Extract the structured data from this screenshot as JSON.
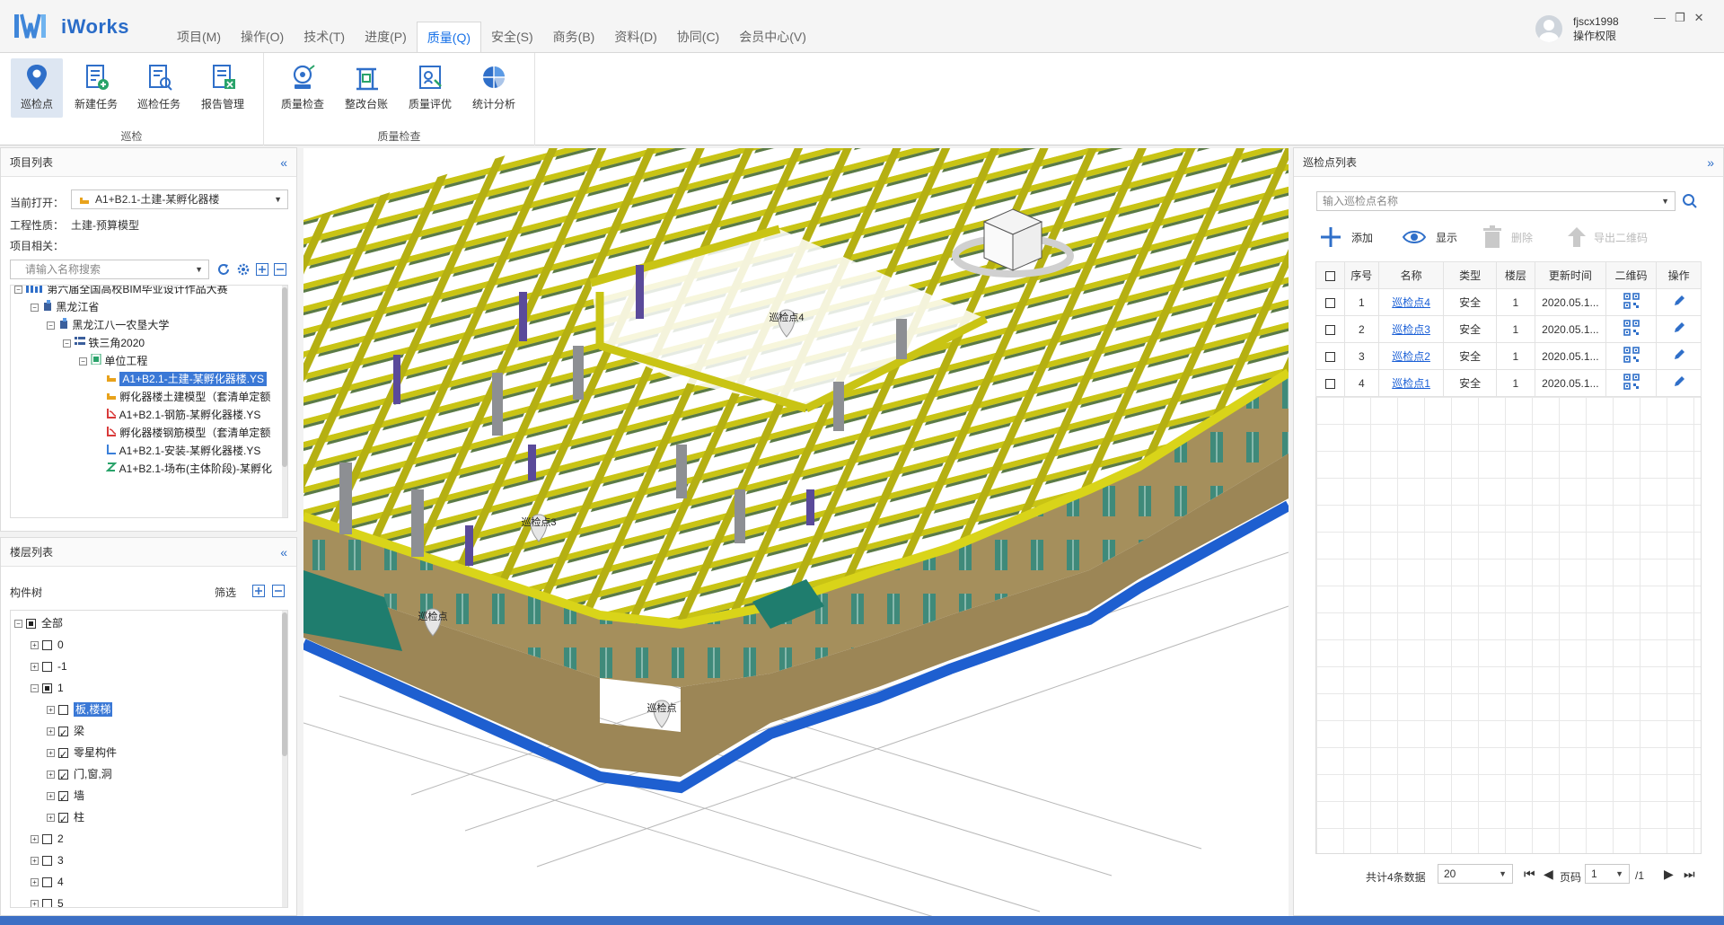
{
  "app": {
    "name": "iWorks"
  },
  "menu": [
    {
      "label": "项目(M)",
      "active": false
    },
    {
      "label": "操作(O)",
      "active": false
    },
    {
      "label": "技术(T)",
      "active": false
    },
    {
      "label": "进度(P)",
      "active": false
    },
    {
      "label": "质量(Q)",
      "active": true
    },
    {
      "label": "安全(S)",
      "active": false
    },
    {
      "label": "商务(B)",
      "active": false
    },
    {
      "label": "资料(D)",
      "active": false
    },
    {
      "label": "协同(C)",
      "active": false
    },
    {
      "label": "会员中心(V)",
      "active": false
    }
  ],
  "user": {
    "name": "fjscx1998",
    "role": "操作权限"
  },
  "window_controls": {
    "minimize": "—",
    "restore": "❐",
    "close": "✕"
  },
  "ribbon": {
    "group1": {
      "label": "巡检",
      "buttons": [
        {
          "label": "巡检点",
          "icon": "map-pin-icon",
          "selected": true
        },
        {
          "label": "新建任务",
          "icon": "new-task-icon"
        },
        {
          "label": "巡检任务",
          "icon": "inspection-task-icon"
        },
        {
          "label": "报告管理",
          "icon": "report-management-icon"
        }
      ]
    },
    "group2": {
      "label": "质量检查",
      "buttons": [
        {
          "label": "质量检查",
          "icon": "quality-check-icon"
        },
        {
          "label": "整改台账",
          "icon": "rectification-ledger-icon"
        },
        {
          "label": "质量评优",
          "icon": "quality-rating-icon"
        },
        {
          "label": "统计分析",
          "icon": "pie-chart-icon"
        }
      ]
    }
  },
  "project_panel": {
    "title": "项目列表",
    "collapse": "«",
    "current_open_label": "当前打开：",
    "current_open_value": "A1+B2.1-土建-某孵化器楼",
    "nature_label": "工程性质：",
    "nature_value": "土建-预算模型",
    "related_label": "项目相关：",
    "search_placeholder": "请输入名称搜索",
    "tree": [
      {
        "label": "第六届全国高校BIM毕业设计作品大赛"
      },
      {
        "label": "黑龙江省"
      },
      {
        "label": "黑龙江八一农垦大学"
      },
      {
        "label": "铁三角2020"
      },
      {
        "label": "单位工程"
      },
      {
        "label": "A1+B2.1-土建-某孵化器楼.YS"
      },
      {
        "label": "孵化器楼土建模型（套清单定额"
      },
      {
        "label": "A1+B2.1-钢筋-某孵化器楼.YS"
      },
      {
        "label": "孵化器楼钢筋模型（套清单定额"
      },
      {
        "label": "A1+B2.1-安装-某孵化器楼.YS"
      },
      {
        "label": "A1+B2.1-场布(主体阶段)-某孵化"
      }
    ]
  },
  "floor_panel": {
    "title": "楼层列表",
    "collapse": "«",
    "tree_label": "构件树",
    "filter_label": "筛选",
    "items": [
      {
        "label": "全部"
      },
      {
        "label": "0"
      },
      {
        "label": "-1"
      },
      {
        "label": "1"
      },
      {
        "label": "板,楼梯"
      },
      {
        "label": "梁"
      },
      {
        "label": "零星构件"
      },
      {
        "label": "门,窗,洞"
      },
      {
        "label": "墙"
      },
      {
        "label": "柱"
      },
      {
        "label": "2"
      },
      {
        "label": "3"
      },
      {
        "label": "4"
      },
      {
        "label": "5"
      }
    ]
  },
  "viewport": {
    "markers": [
      "巡检点4",
      "巡检点3",
      "巡检点",
      "巡检点"
    ],
    "colors": {
      "beam": "#c9c414",
      "wall": "#a58f5c",
      "column": "#8d8f93",
      "window": "#3f8a7a",
      "base": "#1e5fd0",
      "purple": "#5a4a9a"
    }
  },
  "inspection_panel": {
    "title": "巡检点列表",
    "collapse": "»",
    "search_placeholder": "输入巡检点名称",
    "toolbar": {
      "add": "添加",
      "show": "显示",
      "delete": "删除",
      "export_qr": "导出二维码"
    },
    "columns": [
      "序号",
      "名称",
      "类型",
      "楼层",
      "更新时间",
      "二维码",
      "操作"
    ],
    "rows": [
      {
        "no": "1",
        "name": "巡检点4",
        "type": "安全",
        "floor": "1",
        "time": "2020.05.1..."
      },
      {
        "no": "2",
        "name": "巡检点3",
        "type": "安全",
        "floor": "1",
        "time": "2020.05.1..."
      },
      {
        "no": "3",
        "name": "巡检点2",
        "type": "安全",
        "floor": "1",
        "time": "2020.05.1..."
      },
      {
        "no": "4",
        "name": "巡检点1",
        "type": "安全",
        "floor": "1",
        "time": "2020.05.1..."
      }
    ],
    "pager": {
      "total": "共计4条数据",
      "page_size": "20",
      "page_label": "页码",
      "page": "1",
      "page_total": "/1"
    }
  }
}
